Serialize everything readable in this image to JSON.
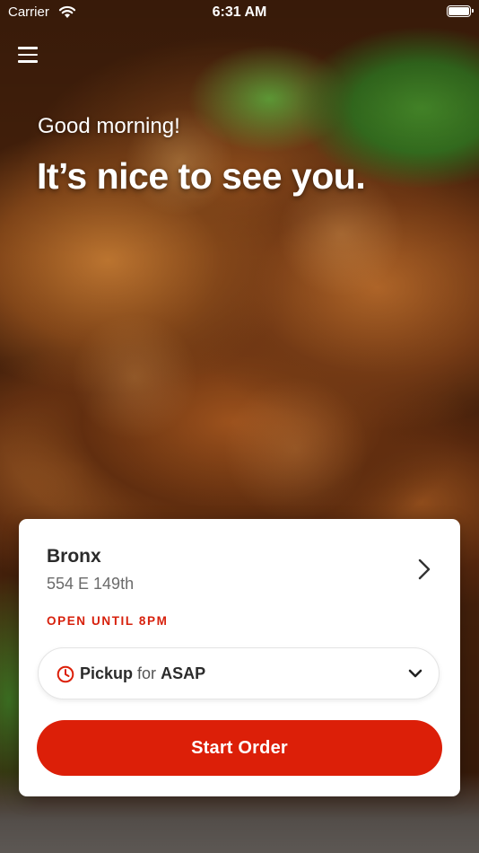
{
  "status_bar": {
    "carrier": "Carrier",
    "time": "6:31 AM",
    "wifi_icon": "wifi-icon",
    "battery_icon": "battery-icon"
  },
  "header": {
    "menu_icon": "hamburger-menu-icon",
    "greeting": "Good morning!",
    "headline": "It’s nice to see you."
  },
  "store_card": {
    "name": "Bronx",
    "address": "554 E 149th",
    "hours": "OPEN UNTIL 8PM",
    "chevron_icon": "chevron-right-icon",
    "pickup": {
      "icon": "clock-icon",
      "method": "Pickup",
      "for": "for",
      "time": "ASAP",
      "dropdown_icon": "chevron-down-icon"
    },
    "start_button": "Start Order"
  },
  "colors": {
    "accent": "#dc1f08",
    "text_dark": "#2b2b2b",
    "text_muted": "#6b6b6b",
    "card_bg": "#ffffff"
  }
}
